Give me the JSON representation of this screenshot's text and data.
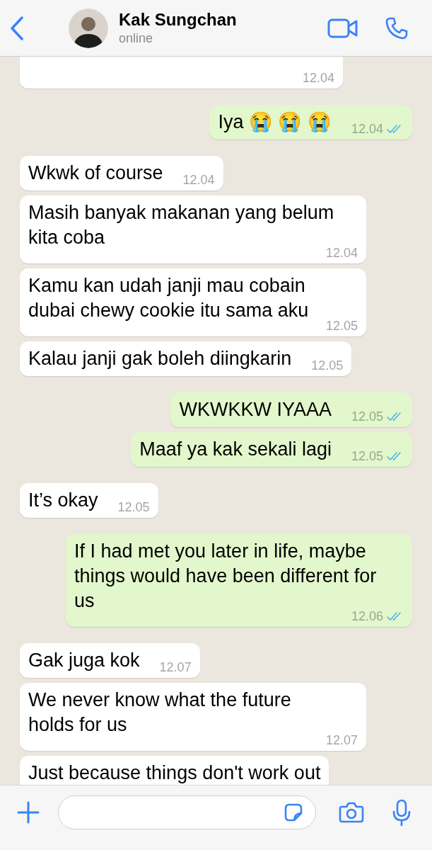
{
  "header": {
    "contact_name": "Kak Sungchan",
    "status": "online"
  },
  "messages": [
    {
      "kind": "incoming",
      "time": "12.04"
    },
    {
      "kind": "outgoing",
      "text": "Iya 😭 😭 😭",
      "time": "12.04",
      "read": true
    },
    {
      "kind": "incoming",
      "text": "Wkwk of course",
      "time": "12.04"
    },
    {
      "kind": "incoming",
      "text": "Masih banyak makanan yang belum kita coba",
      "time": "12.04"
    },
    {
      "kind": "incoming",
      "text": "Kamu kan udah janji mau cobain dubai chewy cookie itu sama aku",
      "time": "12.05"
    },
    {
      "kind": "incoming",
      "text": "Kalau janji gak boleh diingkarin",
      "time": "12.05"
    },
    {
      "kind": "outgoing",
      "text": "WKWKKW IYAAA",
      "time": "12.05",
      "read": true
    },
    {
      "kind": "outgoing",
      "text": "Maaf ya kak sekali lagi",
      "time": "12.05",
      "read": true
    },
    {
      "kind": "incoming",
      "text": "It’s okay",
      "time": "12.05"
    },
    {
      "kind": "outgoing",
      "text": "If I had met you later in life, maybe things would have been different for us",
      "time": "12.06",
      "read": true
    },
    {
      "kind": "incoming",
      "text": "Gak juga kok",
      "time": "12.07"
    },
    {
      "kind": "incoming",
      "text": "We never know what the future holds for us",
      "time": "12.07"
    },
    {
      "kind": "incoming",
      "text": "Just because things don't work out"
    }
  ]
}
